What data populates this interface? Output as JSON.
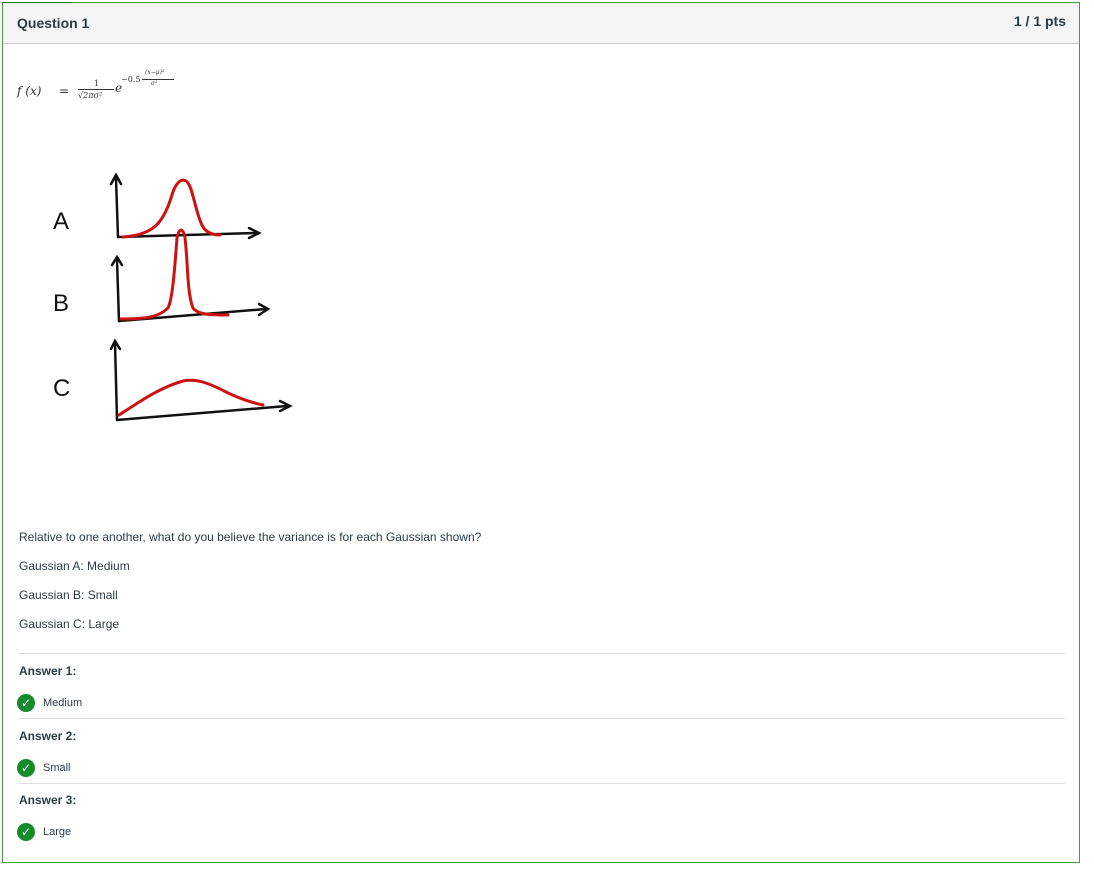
{
  "question": {
    "title": "Question 1",
    "points": "1 / 1 pts"
  },
  "formula": {
    "lhs": "f (x)",
    "equals": "=",
    "frac_numerator": "1",
    "frac_denominator": "√2πσ²",
    "base": "e",
    "exp_coef": "−0.5",
    "exp_numerator": "(x−μ)²",
    "exp_denominator": "σ²"
  },
  "sketch": {
    "labels": [
      "A",
      "B",
      "C"
    ],
    "curve_color": "#cc1111",
    "axis_color": "#111111"
  },
  "prompt": {
    "question_text": "Relative to one another, what do you believe the variance is for each Gaussian shown?",
    "lines": [
      "Gaussian A: Medium",
      "Gaussian B: Small",
      "Gaussian C: Large"
    ]
  },
  "answers": [
    {
      "label": "Answer 1:",
      "value": "Medium",
      "icon": "check-circle-icon"
    },
    {
      "label": "Answer 2:",
      "value": "Small",
      "icon": "check-circle-icon"
    },
    {
      "label": "Answer 3:",
      "value": "Large",
      "icon": "check-circle-icon"
    }
  ],
  "colors": {
    "correct_green": "#188a2e",
    "border_green": "#4a9a3a",
    "header_bg": "#f5f5f5"
  }
}
